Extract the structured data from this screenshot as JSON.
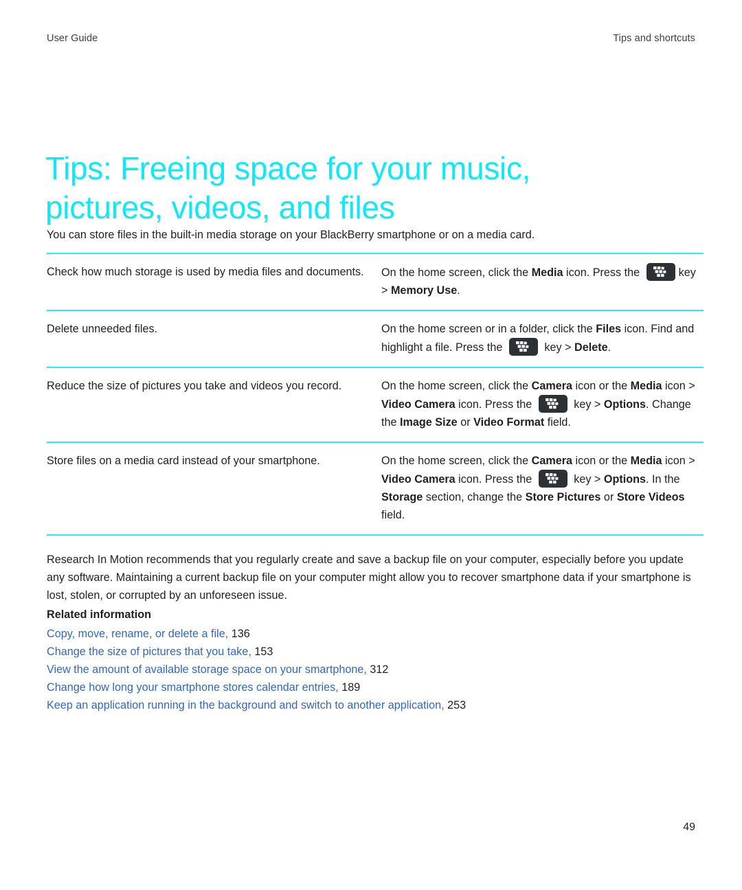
{
  "header": {
    "left": "User Guide",
    "right": "Tips and shortcuts"
  },
  "title": "Tips: Freeing space for your music, pictures, videos, and files",
  "intro": "You can store files in the built-in media storage on your BlackBerry smartphone or on a media card.",
  "colors": {
    "accent_cyan": "#2ee9f7",
    "title_cyan": "#11e8f5",
    "link_blue": "#3267c0",
    "body_text": "#231f20",
    "key_icon_background": "#2b3135"
  },
  "tips_table": {
    "rows": [
      {
        "task": "Check how much storage is used by media files and documents.",
        "action": {
          "line1_prefix": "On the home screen, click the ",
          "line1_bold": "Media",
          "line1_mid": " icon. Press the ",
          "icon": "blackberry-menu-key-icon",
          "line2_prefix": "key > ",
          "line2_bold": "Memory Use",
          "line2_suffix": "."
        }
      },
      {
        "task": "Delete unneeded files.",
        "action": {
          "line1_prefix": "On the home screen or in a folder, click the ",
          "line1_bold": "Files",
          "line1_mid": " icon. Find and highlight a file. Press the ",
          "icon": "blackberry-menu-key-icon",
          "line2_prefix": " key > ",
          "line2_bold": "Delete",
          "line2_suffix": "."
        }
      },
      {
        "task": "Reduce the size of pictures you take and videos you record.",
        "action": {
          "line1_prefix": "On the home screen, click the ",
          "line1_bold": "Camera",
          "line1_mid": " icon or the ",
          "line1_bold2": "Media",
          "line1_mid2": " icon > ",
          "line1_bold3": "Video Camera",
          "line1_mid3": " icon. Press the ",
          "icon": "blackberry-menu-key-icon",
          "line2_prefix": " key > ",
          "line2_bold": "Options",
          "line2_mid": ". Change the ",
          "line2_bold2": "Image Size",
          "line2_mid2": " or ",
          "line2_bold3": "Video Format",
          "line2_suffix": " field."
        }
      },
      {
        "task": "Store files on a media card instead of your smartphone.",
        "action": {
          "line1_prefix": "On the home screen, click the ",
          "line1_bold": "Camera",
          "line1_mid": " icon or the ",
          "line1_bold2": "Media",
          "line1_mid2": " icon > ",
          "line1_bold3": "Video Camera",
          "line1_mid3": " icon. Press the ",
          "icon": "blackberry-menu-key-icon",
          "line2_prefix": " key > ",
          "line2_bold": "Options",
          "line2_mid": ". In the ",
          "line2_bold2": "Storage",
          "line2_mid2": " section, change the ",
          "line2_bold3": "Store Pictures",
          "line2_mid3": " or ",
          "line2_bold4": "Store Videos",
          "line2_suffix": " field."
        }
      }
    ]
  },
  "closing_paragraph": "Research In Motion recommends that you regularly create and save a backup file on your computer, especially before you update any software. Maintaining a current backup file on your computer might allow you to recover smartphone data if your smartphone is lost, stolen, or corrupted by an unforeseen issue.",
  "related": {
    "heading": "Related information",
    "items": [
      {
        "label": "Copy, move, rename, or delete a file,",
        "page": "136"
      },
      {
        "label": "Change the size of pictures that you take,",
        "page": "153"
      },
      {
        "label": "View the amount of available storage space on your smartphone,",
        "page": "312"
      },
      {
        "label": "Change how long your smartphone stores calendar entries,",
        "page": "189"
      },
      {
        "label": "Keep an application running in the background and switch to another application,",
        "page": "253"
      }
    ]
  },
  "folio": "49"
}
